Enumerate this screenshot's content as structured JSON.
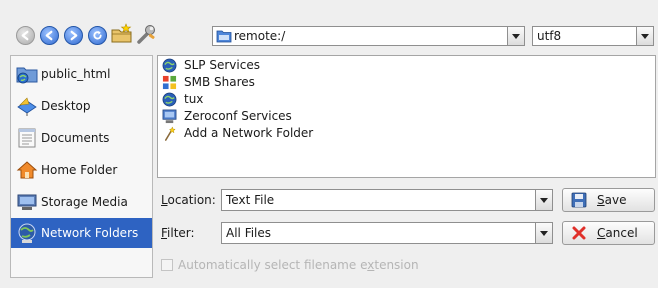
{
  "toolbar": {
    "back_icon": "back-arrow-icon",
    "forward_icon": "forward-arrow-icon",
    "up_icon": "up-arrow-icon",
    "reload_icon": "reload-icon",
    "new_folder_icon": "new-folder-icon",
    "options_icon": "wrench-icon"
  },
  "url_bar": {
    "value": "remote:/"
  },
  "encoding": {
    "value": "utf8"
  },
  "sidebar": {
    "items": [
      {
        "label": "public_html",
        "icon": "folder-web-icon"
      },
      {
        "label": "Desktop",
        "icon": "desktop-icon"
      },
      {
        "label": "Documents",
        "icon": "documents-icon"
      },
      {
        "label": "Home Folder",
        "icon": "home-icon"
      },
      {
        "label": "Storage Media",
        "icon": "storage-icon"
      },
      {
        "label": "Network Folders",
        "icon": "network-globe-icon",
        "selected": true
      }
    ]
  },
  "files": [
    {
      "name": "SLP Services",
      "icon": "globe-icon"
    },
    {
      "name": "SMB Shares",
      "icon": "smb-icon"
    },
    {
      "name": "tux",
      "icon": "globe-icon"
    },
    {
      "name": "Zeroconf Services",
      "icon": "monitor-icon"
    },
    {
      "name": "Add a Network Folder",
      "icon": "wizard-wand-icon"
    }
  ],
  "location": {
    "label_first": "L",
    "label_rest": "ocation:",
    "value": "Text File"
  },
  "filter": {
    "label_first": "F",
    "label_rest": "ilter:",
    "value": "All Files"
  },
  "buttons": {
    "save_first": "S",
    "save_rest": "ave",
    "cancel_first": "C",
    "cancel_rest": "ancel"
  },
  "auto_extension": {
    "label_a": "Automatically select filename e",
    "label_u": "x",
    "label_b": "tension",
    "checked": false
  },
  "colors": {
    "selection": "#2e63c2",
    "nav_active": "#2f69d0"
  }
}
